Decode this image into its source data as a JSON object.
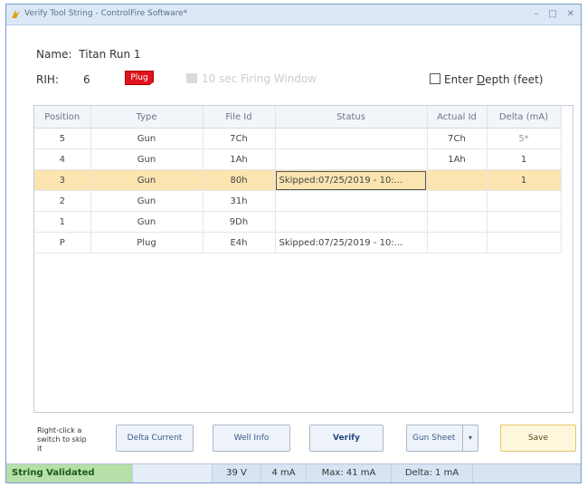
{
  "window": {
    "title": "Verify Tool String - ControlFire Software*",
    "minimize": "–",
    "maximize": "□",
    "close": "✕"
  },
  "header": {
    "name_label": "Name:",
    "name_value": "Titan Run 1",
    "rih_label": "RIH:",
    "rih_value": "6",
    "plug_badge": "Plug",
    "firing_window_label": "10 sec Firing Window",
    "depth_label_pre": "Enter ",
    "depth_label_u": "D",
    "depth_label_post": "epth (feet)"
  },
  "table": {
    "columns": [
      "Position",
      "Type",
      "File Id",
      "Status",
      "Actual Id",
      "Delta (mA)"
    ],
    "rows": [
      {
        "position": "5",
        "type": "Gun",
        "file_id": "7Ch",
        "status": "",
        "actual_id": "7Ch",
        "delta": "5*"
      },
      {
        "position": "4",
        "type": "Gun",
        "file_id": "1Ah",
        "status": "",
        "actual_id": "1Ah",
        "delta": "1"
      },
      {
        "position": "3",
        "type": "Gun",
        "file_id": "80h",
        "status": "Skipped:07/25/2019 - 10:...",
        "actual_id": "",
        "delta": "1"
      },
      {
        "position": "2",
        "type": "Gun",
        "file_id": "31h",
        "status": "",
        "actual_id": "",
        "delta": ""
      },
      {
        "position": "1",
        "type": "Gun",
        "file_id": "9Dh",
        "status": "",
        "actual_id": "",
        "delta": ""
      },
      {
        "position": "P",
        "type": "Plug",
        "file_id": "E4h",
        "status": "Skipped:07/25/2019 - 10:...",
        "actual_id": "",
        "delta": ""
      }
    ]
  },
  "footer": {
    "hint": "Right-click a switch to skip it",
    "delta_current": "Delta Current",
    "well_info": "Well Info",
    "verify": "Verify",
    "gun_sheet": "Gun Sheet",
    "gun_sheet_arrow": "▾",
    "save": "Save"
  },
  "statusbar": {
    "state": "String Validated",
    "voltage": "39 V",
    "current": "4 mA",
    "max": "Max: 41 mA",
    "delta": "Delta: 1 mA"
  },
  "colors": {
    "selected_row": "#fbe4b0",
    "validated": "#b7dfa8",
    "plug_red": "#e0141e"
  }
}
